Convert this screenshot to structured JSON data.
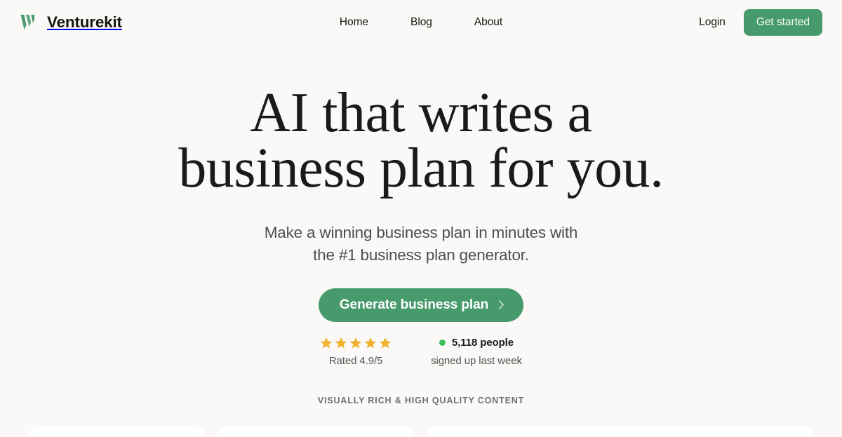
{
  "brand": {
    "name": "Venturekit",
    "logo_icon": "venturekit-chevron-logo",
    "logo_color": "#479a6b"
  },
  "nav": {
    "links": [
      {
        "label": "Home"
      },
      {
        "label": "Blog"
      },
      {
        "label": "About"
      }
    ],
    "login_label": "Login",
    "get_started_label": "Get started"
  },
  "hero": {
    "headline_line1": "AI that writes a",
    "headline_line2": "business plan for you.",
    "subhead_line1": "Make a winning business plan in minutes with",
    "subhead_line2": "the #1 business plan generator.",
    "cta_label": "Generate business plan",
    "cta_chevron_icon": "chevron-right-icon"
  },
  "social_proof": {
    "star_icon": "star-icon",
    "star_count": 5,
    "star_color": "#efb230",
    "rating_text": "Rated 4.9/5",
    "status_dot_icon": "status-dot-icon",
    "status_dot_color": "#3cbf57",
    "signup_count": "5,118 people",
    "signup_sub": "signed up last week"
  },
  "section": {
    "label": "VISUALLY RICH & HIGH QUALITY CONTENT"
  },
  "cards": [
    {
      "name": "content-card-1"
    },
    {
      "name": "content-card-2"
    },
    {
      "name": "content-card-3"
    }
  ],
  "theme": {
    "background": "#faf9f7",
    "accent_green": "#479a6b",
    "text_dark": "#1a1a18",
    "text_muted": "#53534f"
  }
}
